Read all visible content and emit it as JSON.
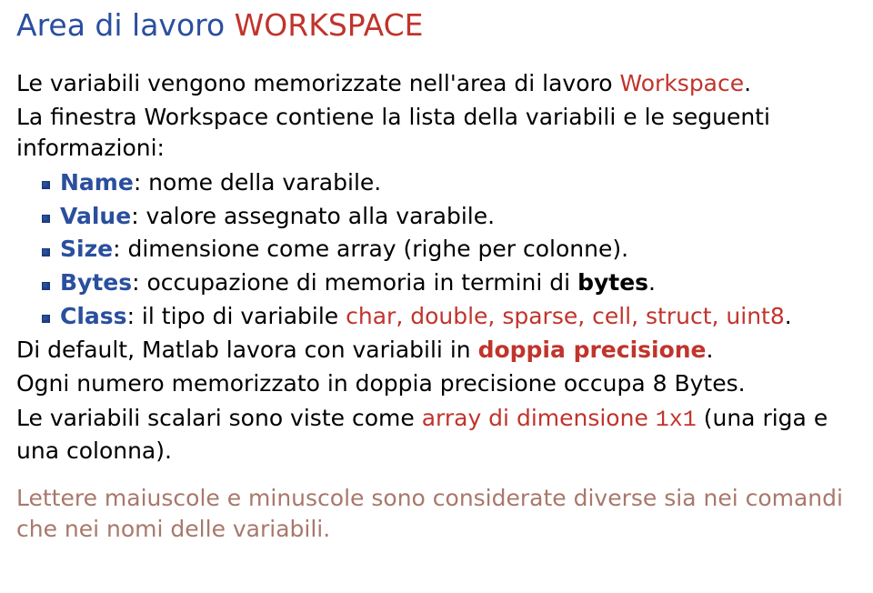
{
  "title_part1": "Area di lavoro ",
  "title_part2": "WORKSPACE",
  "intro_part1": "Le variabili vengono memorizzate nell'area di lavoro ",
  "intro_workspace": "Workspace",
  "intro_part2": ".",
  "lead_in": "La finestra Workspace contiene la lista della variabili e le seguenti informazioni:",
  "items": [
    {
      "label": "Name",
      "rest": ": nome della varabile."
    },
    {
      "label": "Value",
      "rest": ": valore assegnato alla varabile."
    },
    {
      "label": "Size",
      "rest": ": dimensione come array (righe per colonne)."
    },
    {
      "label": "Bytes",
      "rest_pre": ": occupazione di memoria in termini di ",
      "bold": "bytes",
      "rest_post": "."
    },
    {
      "label": "Class",
      "rest_pre": ": il tipo di variabile ",
      "hl": "char, double, sparse, cell, struct, uint8",
      "rest_post": "."
    }
  ],
  "default_part1": "Di default, Matlab lavora con variabili in ",
  "default_hl": "doppia precisione",
  "default_part2": ".",
  "bytes_line": "Ogni numero memorizzato in doppia precisione occupa 8 Bytes.",
  "scalar_part1": "Le variabili scalari sono viste come  ",
  "scalar_hl1": "array di dimensione ",
  "scalar_hl2": "1x1",
  "scalar_part2": " (una riga e una colonna).",
  "footnote": "Lettere maiuscole e minuscole sono considerate diverse sia nei comandi che nei nomi delle variabili."
}
